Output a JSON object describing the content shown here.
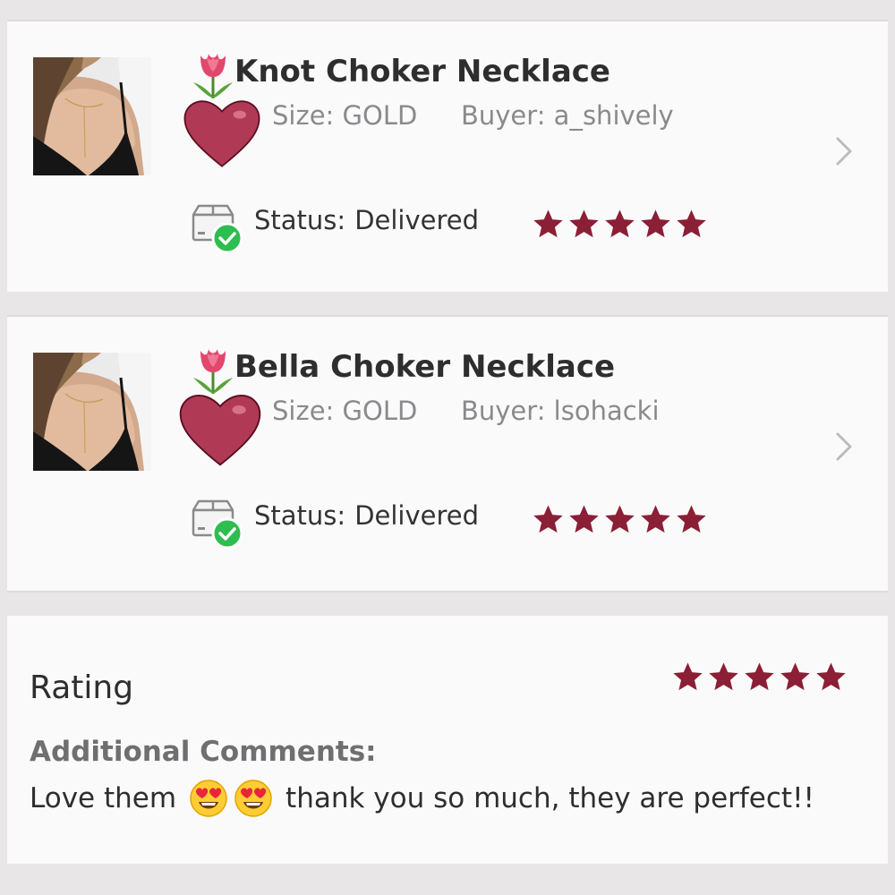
{
  "orders": [
    {
      "title": "Knot Choker Necklace",
      "size": "Size: GOLD",
      "buyer": "Buyer: a_shively",
      "status_label": "Status:",
      "status_value": "Delivered",
      "stars": 5
    },
    {
      "title": "Bella Choker Necklace",
      "size": "Size: GOLD",
      "buyer": "Buyer: lsohacki",
      "status_label": "Status:",
      "status_value": "Delivered",
      "stars": 5
    }
  ],
  "review": {
    "rating_label": "Rating",
    "rating_stars": 5,
    "comments_label": "Additional Comments:",
    "comment_before": "Love them",
    "comment_after": "thank you so much, they are perfect!!"
  },
  "icons": {
    "decor_1": "tulip-icon",
    "decor_2": "heart-icon",
    "status": "delivered-box-icon",
    "nav": "chevron-right-icon",
    "emoji": "heart-eyes-emoji-icon"
  },
  "colors": {
    "star": "#8b1f35",
    "heart": "#b03a56",
    "check": "#2ebd4f",
    "background": "#fbfafb"
  }
}
